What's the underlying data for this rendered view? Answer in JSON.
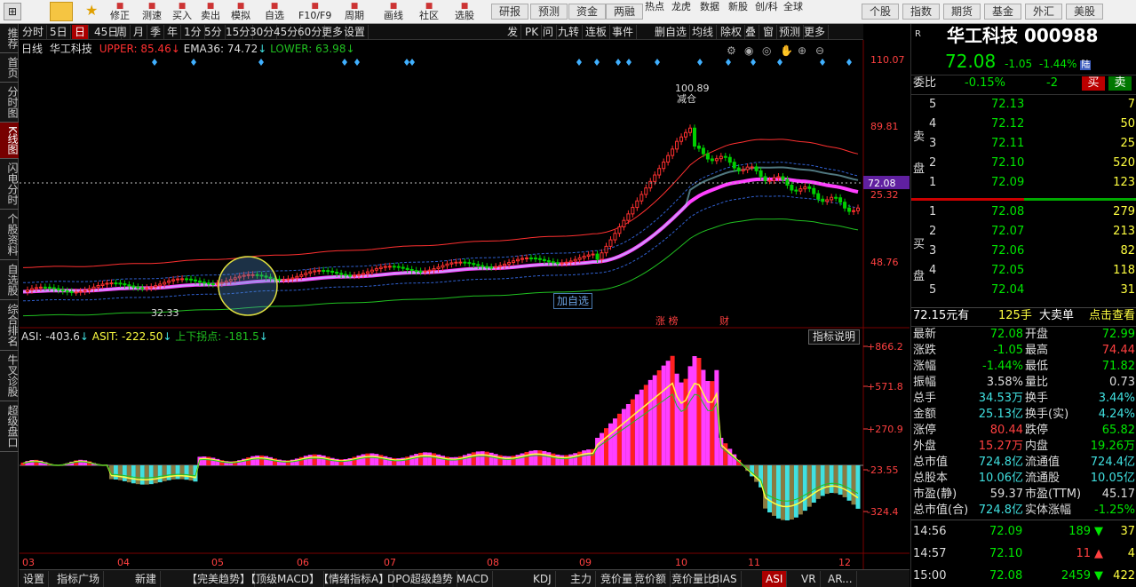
{
  "toolbar": {
    "left": [
      "修正",
      "测速",
      "买入",
      "卖出",
      "模拟",
      "自选",
      "F10/F9",
      "周期",
      "画线",
      "社区",
      "选股",
      "研报",
      "预测",
      "资金",
      "两融",
      "热点",
      "龙虎",
      "数据",
      "新股",
      "创/科",
      "全球"
    ],
    "right": [
      "个股",
      "指数",
      "期货",
      "基金",
      "外汇",
      "美股"
    ]
  },
  "sidebar": [
    "推荐",
    "首页",
    "分时图",
    "K线图",
    "闪电分时",
    "个股资料",
    "自选股",
    "综合排名",
    "牛叉诊股",
    "超级盘口"
  ],
  "periods": [
    "分时",
    "5日",
    "日",
    "45日",
    "周",
    "月",
    "季",
    "年",
    "1分",
    "5分",
    "15分",
    "30分",
    "45分",
    "60分",
    "更多",
    "设置"
  ],
  "tools": [
    "发",
    "PK",
    "问",
    "九转",
    "连板",
    "事件",
    "删自选",
    "均线",
    "除权",
    "叠",
    "窗",
    "预测",
    "更多"
  ],
  "main_legend": {
    "period": "日线",
    "name": "华工科技",
    "upper": "UPPER: 85.46",
    "ema": "EMA36: 74.72",
    "lower": "LOWER: 63.98"
  },
  "price_axis": [
    "110.07",
    "89.81",
    "72.08",
    "25.32",
    "48.76"
  ],
  "annotations": {
    "high": "100.89",
    "low": "32.33",
    "reduce": "减仓",
    "add_watch": "加自选",
    "zhangbang": "涨 榜",
    "cai": "财"
  },
  "asi_legend": {
    "asi": "ASI: -403.6",
    "asit": "ASIT: -222.50",
    "turn": "上下拐点: -181.5",
    "help": "指标说明"
  },
  "asi_axis": [
    "+866.2",
    "+571.8",
    "+270.9",
    "-23.55",
    "-324.4"
  ],
  "months": [
    "03",
    "04",
    "05",
    "06",
    "07",
    "08",
    "09",
    "10",
    "11",
    "12"
  ],
  "bottom_tabs": [
    "设置",
    "指标广场",
    "新建",
    "【完美趋势】",
    "【顶级MACD】",
    "【情绪指标A】",
    "DPO超级趋势",
    "MACD",
    "KDJ",
    "主力",
    "竞价量",
    "竞价额",
    "竞价量比",
    "BIAS",
    "ASI",
    "VR",
    "AR..."
  ],
  "stock": {
    "name": "华工科技",
    "code": "000988",
    "price": "72.08",
    "change": "-1.05",
    "change_pct": "-1.44%",
    "flag": "陆",
    "weibi_label": "委比",
    "weibi": "-0.15%",
    "weicha": "-2",
    "buy_btn": "买",
    "sell_btn": "卖"
  },
  "sell_orders": [
    {
      "lvl": "5",
      "price": "72.13",
      "vol": "7"
    },
    {
      "lvl": "4",
      "price": "72.12",
      "vol": "50"
    },
    {
      "lvl": "3",
      "price": "72.11",
      "vol": "25"
    },
    {
      "lvl": "2",
      "price": "72.10",
      "vol": "520"
    },
    {
      "lvl": "1",
      "price": "72.09",
      "vol": "123"
    }
  ],
  "buy_orders": [
    {
      "lvl": "1",
      "price": "72.08",
      "vol": "279"
    },
    {
      "lvl": "2",
      "price": "72.07",
      "vol": "213"
    },
    {
      "lvl": "3",
      "price": "72.06",
      "vol": "82"
    },
    {
      "lvl": "4",
      "price": "72.05",
      "vol": "118"
    },
    {
      "lvl": "5",
      "price": "72.04",
      "vol": "31"
    }
  ],
  "sell_label": [
    "卖",
    "盘"
  ],
  "buy_label": [
    "买",
    "盘"
  ],
  "big_order": {
    "price": "72.15元有",
    "vol": "125手",
    "type": "大卖单",
    "link": "点击查看"
  },
  "stats": [
    {
      "k1": "最新",
      "v1": "72.08",
      "c1": "green",
      "k2": "开盘",
      "v2": "72.99",
      "c2": "green"
    },
    {
      "k1": "涨跌",
      "v1": "-1.05",
      "c1": "green",
      "k2": "最高",
      "v2": "74.44",
      "c2": "red"
    },
    {
      "k1": "涨幅",
      "v1": "-1.44%",
      "c1": "green",
      "k2": "最低",
      "v2": "71.82",
      "c2": "green"
    },
    {
      "k1": "振幅",
      "v1": "3.58%",
      "c1": "white",
      "k2": "量比",
      "v2": "0.73",
      "c2": "white"
    },
    {
      "k1": "总手",
      "v1": "34.53万",
      "c1": "cyan",
      "k2": "换手",
      "v2": "3.44%",
      "c2": "cyan"
    },
    {
      "k1": "金额",
      "v1": "25.13亿",
      "c1": "cyan",
      "k2": "换手(实)",
      "v2": "4.24%",
      "c2": "cyan"
    },
    {
      "k1": "涨停",
      "v1": "80.44",
      "c1": "red",
      "k2": "跌停",
      "v2": "65.82",
      "c2": "green"
    },
    {
      "k1": "外盘",
      "v1": "15.27万",
      "c1": "red",
      "k2": "内盘",
      "v2": "19.26万",
      "c2": "green"
    },
    {
      "k1": "总市值",
      "v1": "724.8亿",
      "c1": "cyan",
      "k2": "流通值",
      "v2": "724.4亿",
      "c2": "cyan"
    },
    {
      "k1": "总股本",
      "v1": "10.06亿",
      "c1": "cyan",
      "k2": "流通股",
      "v2": "10.05亿",
      "c2": "cyan"
    },
    {
      "k1": "市盈(静)",
      "v1": "59.37",
      "c1": "white",
      "k2": "市盈(TTM)",
      "v2": "45.17",
      "c2": "white"
    },
    {
      "k1": "总市值(合)",
      "v1": "724.8亿",
      "c1": "cyan",
      "k2": "实体涨幅",
      "v2": "-1.25%",
      "c2": "green"
    }
  ],
  "ticks": [
    {
      "time": "14:56",
      "price": "72.09",
      "vol": "189",
      "dir": "down",
      "n": "37"
    },
    {
      "time": "14:57",
      "price": "72.10",
      "vol": "11",
      "dir": "up",
      "n": "4"
    },
    {
      "time": "15:00",
      "price": "72.08",
      "vol": "2459",
      "dir": "down",
      "n": "422"
    }
  ],
  "colors": {
    "up": "#ff3030",
    "down": "#00d000",
    "ema": "#ff40ff",
    "upper": "#ff3030",
    "lower": "#20c020"
  }
}
